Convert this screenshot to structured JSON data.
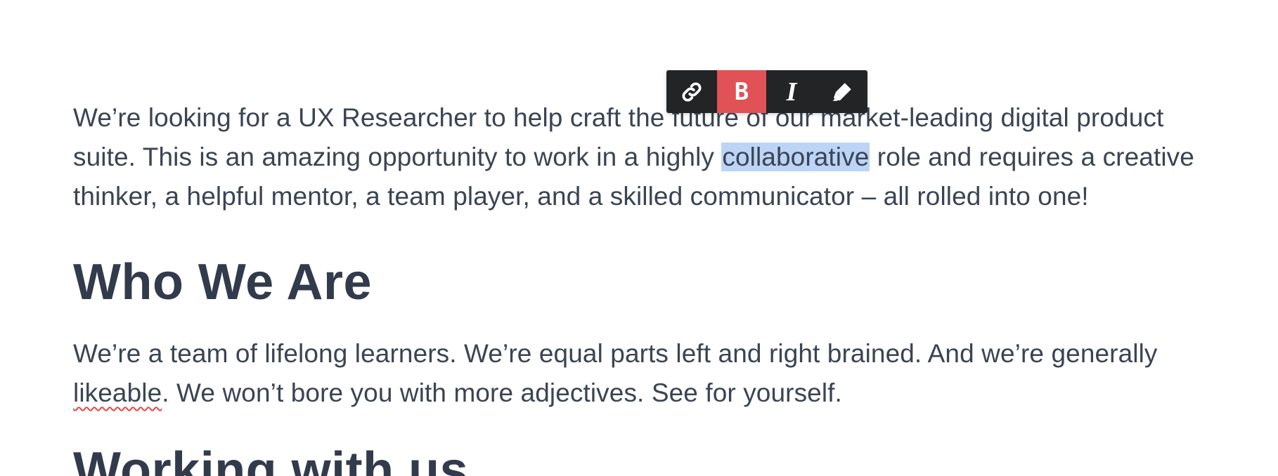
{
  "toolbar": {
    "buttons": [
      {
        "icon": "link-icon",
        "label": "",
        "active": false
      },
      {
        "icon": "bold-icon",
        "label": "B",
        "active": true
      },
      {
        "icon": "italic-icon",
        "label": "I",
        "active": false
      },
      {
        "icon": "highlight-marker-icon",
        "label": "",
        "active": false
      }
    ],
    "active_color": "#e05255",
    "background_color": "#222426"
  },
  "content": {
    "intro": {
      "line1": "We’re looking for a UX Researcher to help craft the future of our market-leading digital product",
      "line2_before": "suite. This is an amazing opportunity to work in a highly ",
      "line2_selected": "collaborative",
      "line2_after": " role and requires a creative",
      "line3": "thinker, a helpful mentor, a team player, and a skilled communicator – all rolled into one!"
    },
    "who_we_are": {
      "heading": "Who We Are",
      "line1": "We’re a team of lifelong learners. We’re equal parts left and right brained. And we’re generally",
      "line2_misspelled": "likeable",
      "line2_rest": ". We won’t bore you with more adjectives. See for yourself."
    },
    "working_with_us": {
      "heading": "Working with us"
    }
  },
  "colors": {
    "text": "#3b4454",
    "selection": "#bcd4f6",
    "spellcheck": "#e0484b"
  }
}
